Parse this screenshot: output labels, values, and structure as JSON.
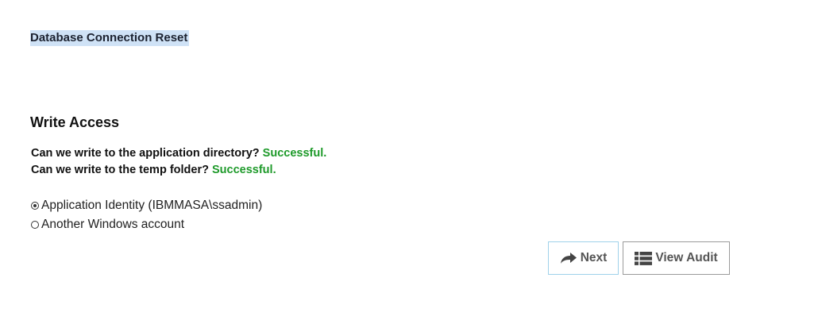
{
  "page": {
    "title": "Database Connection Reset"
  },
  "write_access": {
    "heading": "Write Access",
    "checks": [
      {
        "question": "Can we write to the application directory?",
        "result": "Successful."
      },
      {
        "question": "Can we write to the temp folder?",
        "result": "Successful."
      }
    ]
  },
  "identity_options": [
    {
      "label": "Application Identity (IBMMASA\\ssadmin)",
      "checked": true
    },
    {
      "label": "Another Windows account",
      "checked": false
    }
  ],
  "actions": {
    "next_label": "Next",
    "next_icon": "share-arrow-icon",
    "audit_label": "View Audit",
    "audit_icon": "list-icon"
  },
  "colors": {
    "success": "#1e9a2a",
    "title_highlight": "#cfe2f6",
    "next_border": "#9fd2ea"
  }
}
